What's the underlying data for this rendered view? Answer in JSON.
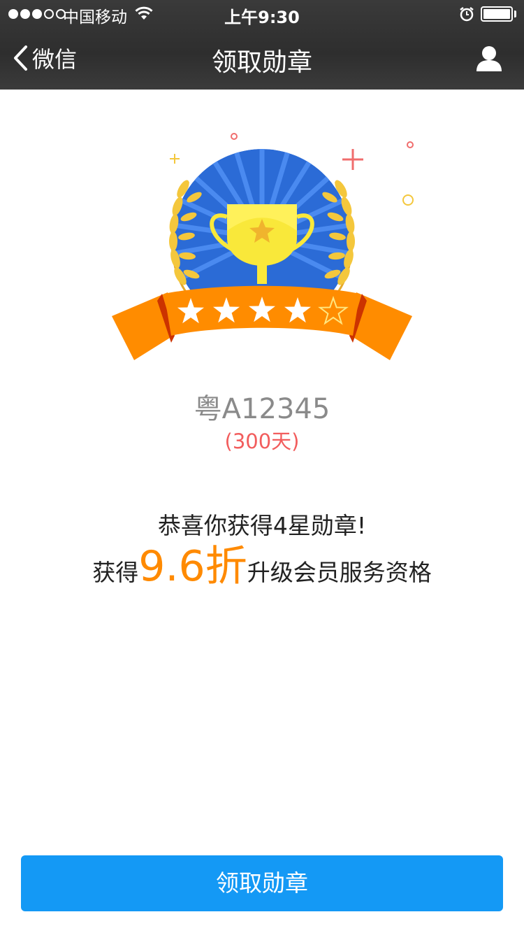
{
  "status_bar": {
    "carrier": "中国移动",
    "time": "上午9:30",
    "signal_bars_filled": 3,
    "signal_bars_total": 5
  },
  "nav": {
    "back_label": "微信",
    "title": "领取勋章",
    "back_icon": "chevron-left-icon",
    "profile_icon": "user-icon"
  },
  "badge": {
    "stars_filled": 4,
    "stars_total": 5,
    "colors": {
      "medal_blue": "#2f6fd8",
      "ribbon_orange": "#ff8c00",
      "cup_yellow": "#f9e83a",
      "laurel_gold": "#f4c73c"
    }
  },
  "plate": "粤A12345",
  "days": "(300天)",
  "message": {
    "congrats": "恭喜你获得4星勋章!",
    "prefix": "获得",
    "discount": "9.6折",
    "suffix": "升级会员服务资格"
  },
  "button": {
    "label": "领取勋章",
    "color": "#1499f5"
  }
}
